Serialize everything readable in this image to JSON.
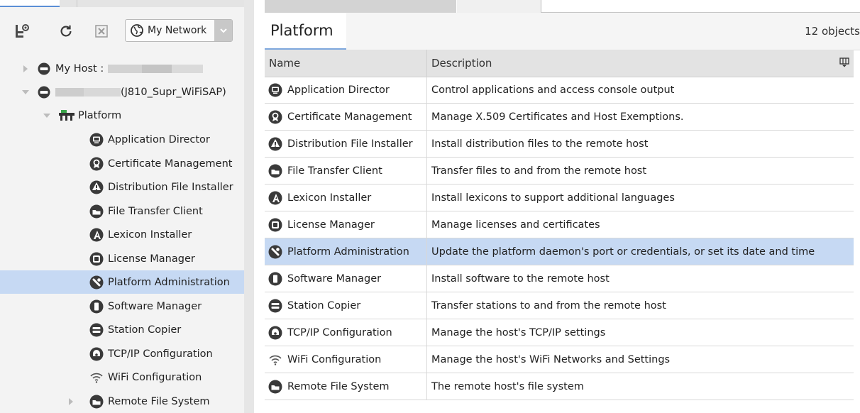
{
  "toolbar": {
    "network_label": "My Network"
  },
  "tree": {
    "host_label": "My Host :",
    "device_suffix": "(J810_Supr_WiFiSAP)",
    "platform_label": "Platform",
    "items": [
      {
        "label": "Application Director",
        "icon": "monitor-icon"
      },
      {
        "label": "Certificate Management",
        "icon": "certificate-icon"
      },
      {
        "label": "Distribution File Installer",
        "icon": "installer-icon"
      },
      {
        "label": "File Transfer Client",
        "icon": "file-transfer-icon"
      },
      {
        "label": "Lexicon Installer",
        "icon": "lexicon-icon"
      },
      {
        "label": "License Manager",
        "icon": "license-icon"
      },
      {
        "label": "Platform Administration",
        "icon": "admin-icon"
      },
      {
        "label": "Software Manager",
        "icon": "software-icon"
      },
      {
        "label": "Station Copier",
        "icon": "station-copier-icon"
      },
      {
        "label": "TCP/IP Configuration",
        "icon": "tcpip-icon"
      },
      {
        "label": "WiFi Configuration",
        "icon": "wifi-icon"
      },
      {
        "label": "Remote File System",
        "icon": "remote-fs-icon"
      }
    ]
  },
  "view": {
    "title": "Platform",
    "count": "12 objects"
  },
  "table": {
    "headers": {
      "name": "Name",
      "description": "Description"
    },
    "rows": [
      {
        "name": "Application Director",
        "description": "Control applications and access console output"
      },
      {
        "name": "Certificate Management",
        "description": "Manage X.509 Certificates and Host Exemptions."
      },
      {
        "name": "Distribution File Installer",
        "description": "Install distribution files to the remote host"
      },
      {
        "name": "File Transfer Client",
        "description": "Transfer files to and from the remote host"
      },
      {
        "name": "Lexicon Installer",
        "description": "Install lexicons to support additional languages"
      },
      {
        "name": "License Manager",
        "description": "Manage licenses and certificates"
      },
      {
        "name": "Platform Administration",
        "description": "Update the platform daemon's port or credentials, or set its date and time"
      },
      {
        "name": "Software Manager",
        "description": "Install software to the remote host"
      },
      {
        "name": "Station Copier",
        "description": "Transfer stations to and from the remote host"
      },
      {
        "name": "TCP/IP Configuration",
        "description": "Manage the host's TCP/IP settings"
      },
      {
        "name": "WiFi Configuration",
        "description": "Manage the host's WiFi Networks and Settings"
      },
      {
        "name": "Remote File System",
        "description": "The remote host's file system"
      }
    ]
  },
  "colors": {
    "selection": "#c6d9f3",
    "icon": "#3a3a3a",
    "accent": "#5b8fd6"
  }
}
